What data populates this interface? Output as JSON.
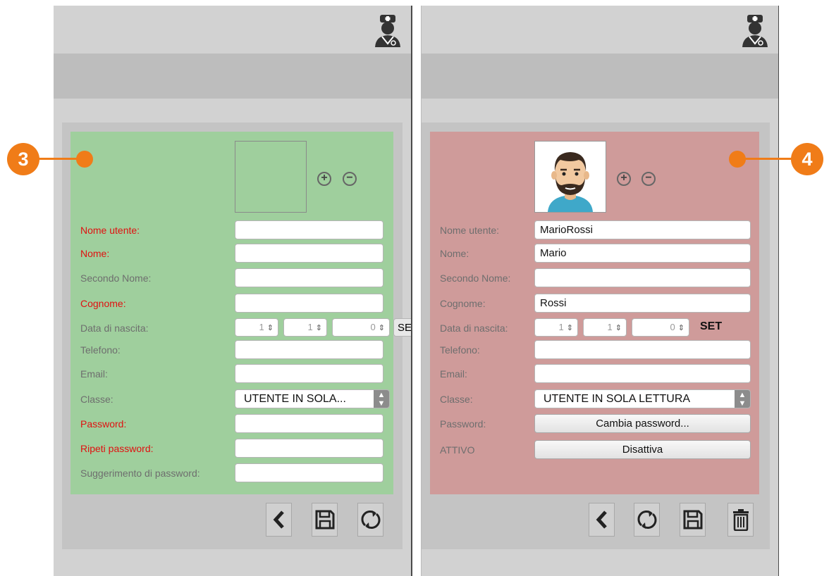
{
  "left_form": {
    "marker": "3",
    "fields": [
      {
        "label": "Nome utente:",
        "value": ""
      },
      {
        "label": "Nome:",
        "value": ""
      },
      {
        "label": "Secondo Nome:",
        "value": ""
      },
      {
        "label": "Cognome:",
        "value": ""
      },
      {
        "label": "Data di nascita:",
        "day": "1",
        "month": "1",
        "year": "0",
        "set": "SET"
      },
      {
        "label": "Telefono:",
        "value": ""
      },
      {
        "label": "Email:",
        "value": ""
      },
      {
        "label": "Classe:",
        "value": "UTENTE IN SOLA..."
      },
      {
        "label": "Password:",
        "value": ""
      },
      {
        "label": "Ripeti password:",
        "value": ""
      },
      {
        "label": "Suggerimento di password:",
        "value": ""
      }
    ]
  },
  "right_form": {
    "marker": "4",
    "fields": [
      {
        "label": "Nome utente:",
        "value": "MarioRossi"
      },
      {
        "label": "Nome:",
        "value": "Mario"
      },
      {
        "label": "Secondo Nome:",
        "value": ""
      },
      {
        "label": "Cognome:",
        "value": "Rossi"
      },
      {
        "label": "Data di nascita:",
        "day": "1",
        "month": "1",
        "year": "0",
        "set": "SET"
      },
      {
        "label": "Telefono:",
        "value": ""
      },
      {
        "label": "Email:",
        "value": ""
      },
      {
        "label": "Classe:",
        "value": "UTENTE IN SOLA LETTURA"
      },
      {
        "label": "Password:",
        "button": "Cambia password..."
      },
      {
        "label": "ATTIVO",
        "button": "Disattiva"
      }
    ]
  },
  "icons": {
    "user": "doctor-icon",
    "add": "plus-circle-icon",
    "remove": "minus-circle-icon",
    "back": "chevron-left-icon",
    "save": "floppy-disk-icon",
    "refresh": "refresh-icon",
    "delete": "trash-icon"
  },
  "colors": {
    "new_user_card": "#9fcf9d",
    "edit_user_card": "#cf9b9a",
    "required_label": "#e01010",
    "marker": "#f07c18"
  }
}
